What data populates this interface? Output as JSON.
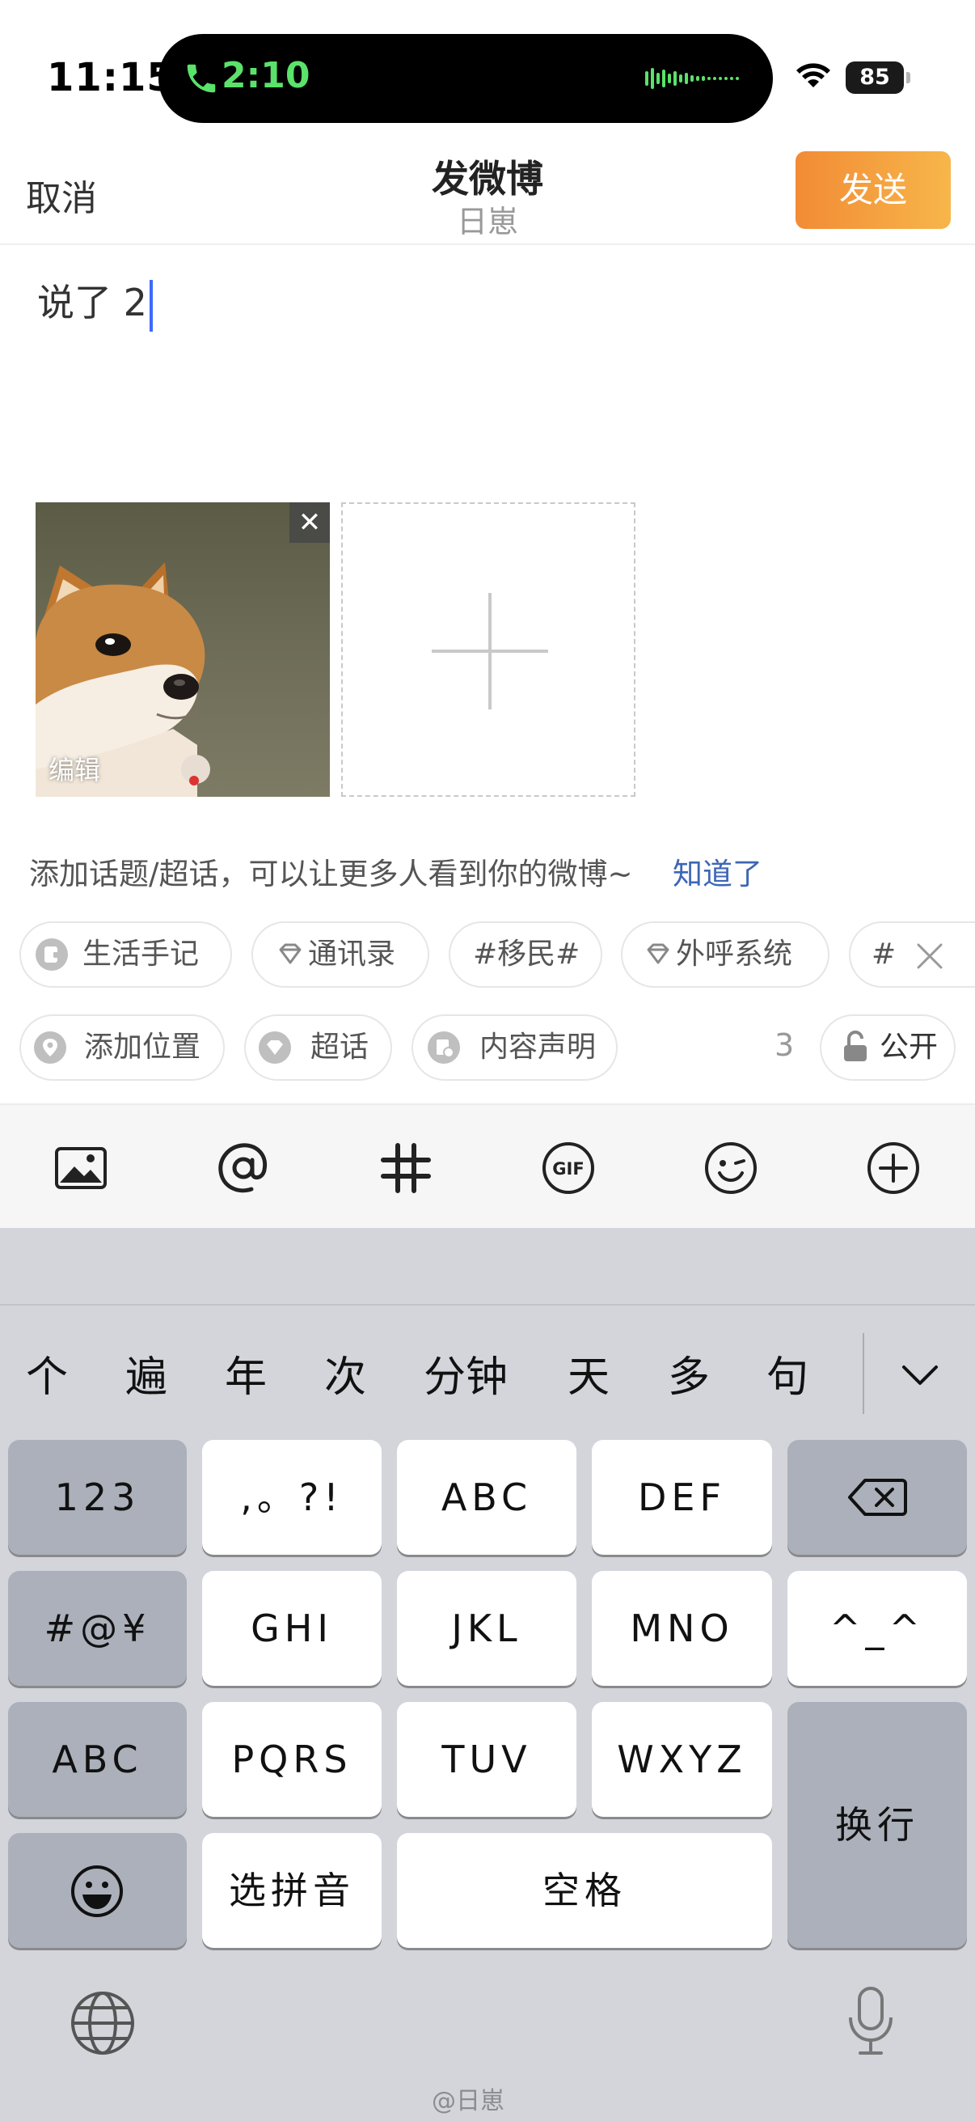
{
  "status_bar": {
    "time": "11:15",
    "call_duration": "2:10",
    "battery": "85",
    "call_color": "#5ae26a"
  },
  "header": {
    "cancel": "取消",
    "title": "发微博",
    "subtitle": "日崽",
    "send": "发送",
    "send_color": "#f28b35"
  },
  "compose": {
    "text": "说了 2",
    "photo_edit": "编辑",
    "photo_close": "✕"
  },
  "hint": {
    "text": "添加话题/超话，可以让更多人看到你的微博~",
    "link": "知道了"
  },
  "topics": [
    {
      "label": "生活手记",
      "icon": "note-icon"
    },
    {
      "label": "通讯录",
      "icon": "diamond-icon"
    },
    {
      "label": "#移民#",
      "icon": ""
    },
    {
      "label": "外呼系统",
      "icon": "diamond-icon"
    },
    {
      "label": "#",
      "icon": ""
    }
  ],
  "options": {
    "location": "添加位置",
    "super_topic": "超话",
    "declaration": "内容声明",
    "counter": "3",
    "visibility": "公开"
  },
  "toolbar": [
    "image-icon",
    "at-icon",
    "hashtag-icon",
    "gif-icon",
    "emoji-icon",
    "plus-circle-icon"
  ],
  "keyboard": {
    "candidates": [
      "个",
      "遍",
      "年",
      "次",
      "分钟",
      "天",
      "多",
      "句"
    ],
    "keys": {
      "num": "123",
      "punct": ",。?!",
      "abc_key": "ABC",
      "def": "DEF",
      "symbols": "#@¥",
      "ghi": "GHI",
      "jkl": "JKL",
      "mno": "MNO",
      "emoticon": "^_^",
      "abc_mode": "ABC",
      "pqrs": "PQRS",
      "tuv": "TUV",
      "wxyz": "WXYZ",
      "newline": "换行",
      "select_pinyin": "选拼音",
      "space": "空格"
    }
  },
  "watermark": "@日崽"
}
